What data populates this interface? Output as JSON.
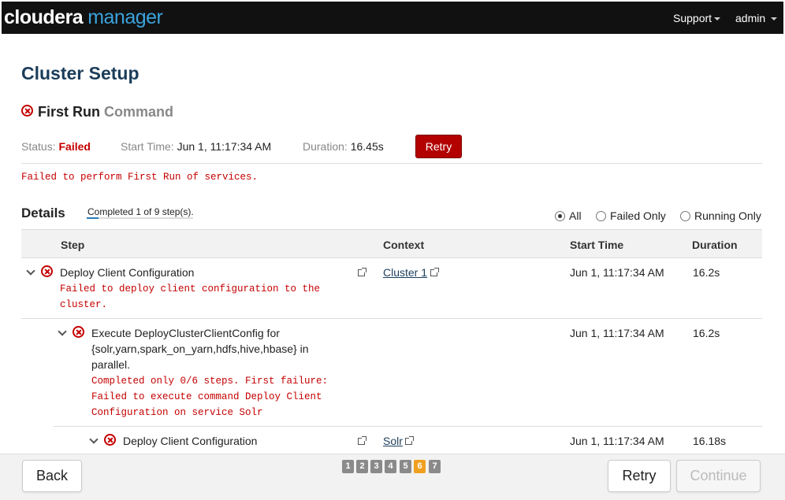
{
  "header": {
    "logo_part1": "cloudera",
    "logo_part2": "manager",
    "nav": {
      "support": "Support",
      "admin": "admin"
    }
  },
  "page_title": "Cluster Setup",
  "command": {
    "title_primary": "First Run",
    "title_secondary": "Command",
    "status_label": "Status:",
    "status_value": "Failed",
    "start_label": "Start Time:",
    "start_value": "Jun 1, 11:17:34 AM",
    "duration_label": "Duration:",
    "duration_value": "16.45s",
    "retry_label": "Retry",
    "failure_message": "Failed to perform First Run of services."
  },
  "details": {
    "title": "Details",
    "progress_text": "Completed 1 of 9 step(s).",
    "progress_fraction": 0.111,
    "filters": [
      "All",
      "Failed Only",
      "Running Only"
    ],
    "selected_filter": "All"
  },
  "table": {
    "columns": [
      "Step",
      "Context",
      "Start Time",
      "Duration"
    ],
    "rows": [
      {
        "step": "Deploy Client Configuration",
        "context": "Cluster 1",
        "start": "Jun 1, 11:17:34 AM",
        "duration": "16.2s",
        "message_lines": [
          "Failed to deploy client configuration to the",
          "cluster."
        ]
      },
      {
        "step_lines": [
          "Execute DeployClusterClientConfig for",
          "{solr,yarn,spark_on_yarn,hdfs,hive,hbase} in",
          "parallel."
        ],
        "context": "",
        "start": "Jun 1, 11:17:34 AM",
        "duration": "16.2s",
        "message_lines": [
          "Completed only 0/6 steps. First failure:",
          "Failed to execute command Deploy Client",
          "Configuration on service Solr"
        ]
      },
      {
        "step": "Deploy Client Configuration",
        "context": "Solr",
        "start": "Jun 1, 11:17:34 AM",
        "duration": "16.18s"
      }
    ]
  },
  "footer": {
    "back_label": "Back",
    "retry_label": "Retry",
    "continue_label": "Continue",
    "pages": [
      "1",
      "2",
      "3",
      "4",
      "5",
      "6",
      "7"
    ],
    "active_page": "6"
  },
  "colors": {
    "accent": "#3aa3dc",
    "error": "#c40000",
    "retry_button": "#b30000",
    "active_page": "#f0a020",
    "title": "#1b3d5a"
  }
}
